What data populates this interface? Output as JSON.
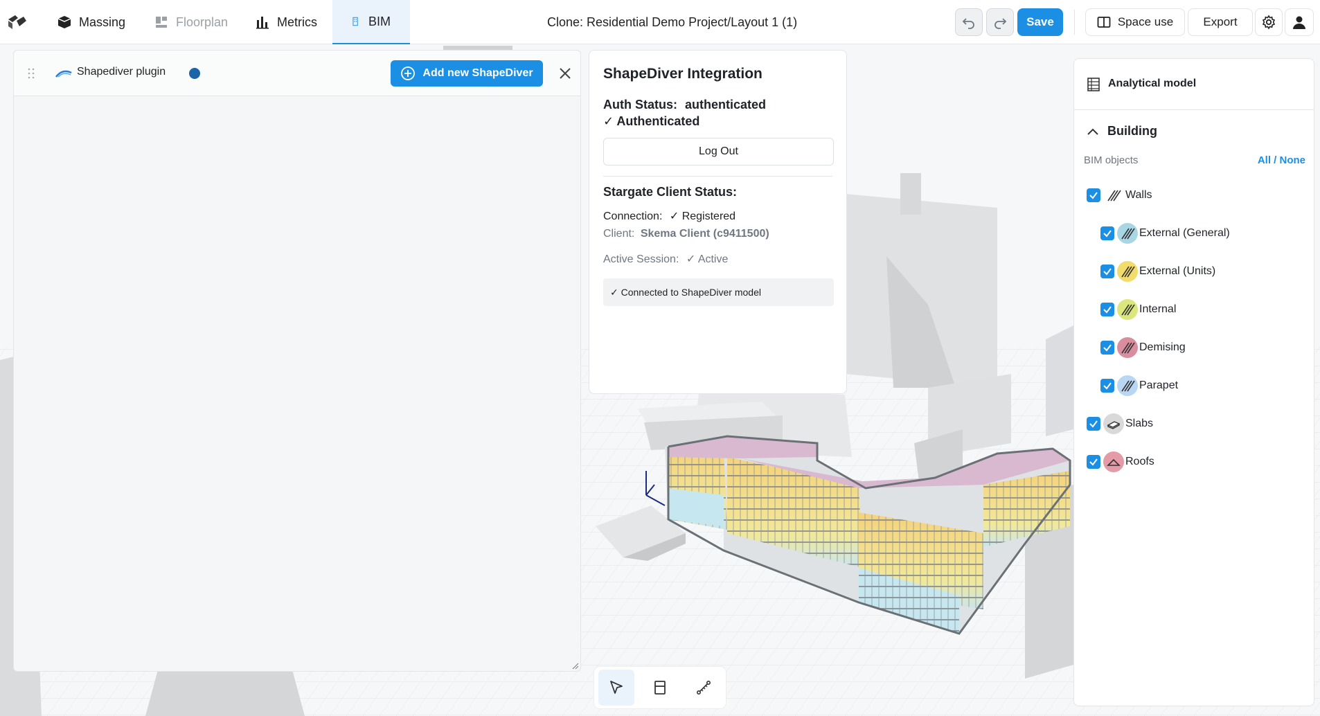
{
  "topbar": {
    "tabs": [
      {
        "label": "Massing",
        "icon": "cube-icon",
        "state": "normal"
      },
      {
        "label": "Floorplan",
        "icon": "floorplan-icon",
        "state": "disabled"
      },
      {
        "label": "Metrics",
        "icon": "bar-chart-icon",
        "state": "normal"
      },
      {
        "label": "BIM",
        "icon": "building-icon",
        "state": "active"
      }
    ],
    "project_title": "Clone: Residential Demo Project/Layout 1 (1)",
    "save_label": "Save",
    "space_use_label": "Space use",
    "export_label": "Export"
  },
  "plugin": {
    "title": "Shapediver plugin",
    "add_button_label": "Add new ShapeDiver",
    "status_color": "#1c64a8"
  },
  "integration": {
    "title": "ShapeDiver Integration",
    "auth_status_label": "Auth Status:",
    "auth_status_value": "authenticated",
    "authenticated_text": "✓ Authenticated",
    "logout_label": "Log Out",
    "client_status_title": "Stargate Client Status:",
    "connection_label": "Connection:",
    "connection_value": "✓ Registered",
    "client_label": "Client:",
    "client_value": "Skema Client (c9411500)",
    "session_label": "Active Session:",
    "session_value": "✓ Active",
    "connected_text": "✓ Connected to ShapeDiver model"
  },
  "analytical": {
    "title": "Analytical model",
    "building_label": "Building",
    "bim_objects_label": "BIM objects",
    "all_none_label": "All / None",
    "layers": [
      {
        "label": "Walls",
        "level": 0,
        "color": "#ffffff",
        "checked": true
      },
      {
        "label": "External (General)",
        "level": 1,
        "color": "#a9d6e5",
        "checked": true
      },
      {
        "label": "External (Units)",
        "level": 1,
        "color": "#f2dc6b",
        "checked": true
      },
      {
        "label": "Internal",
        "level": 1,
        "color": "#dbe77c",
        "checked": true
      },
      {
        "label": "Demising",
        "level": 1,
        "color": "#d98ea0",
        "checked": true
      },
      {
        "label": "Parapet",
        "level": 1,
        "color": "#b9d6f2",
        "checked": true
      },
      {
        "label": "Slabs",
        "level": 0,
        "color": "#d9d9d9",
        "checked": true
      },
      {
        "label": "Roofs",
        "level": 0,
        "color": "#e59aa8",
        "checked": true
      }
    ]
  },
  "colors": {
    "accent": "#1a8fe3",
    "active_tab_bg": "#eaf3fb"
  }
}
